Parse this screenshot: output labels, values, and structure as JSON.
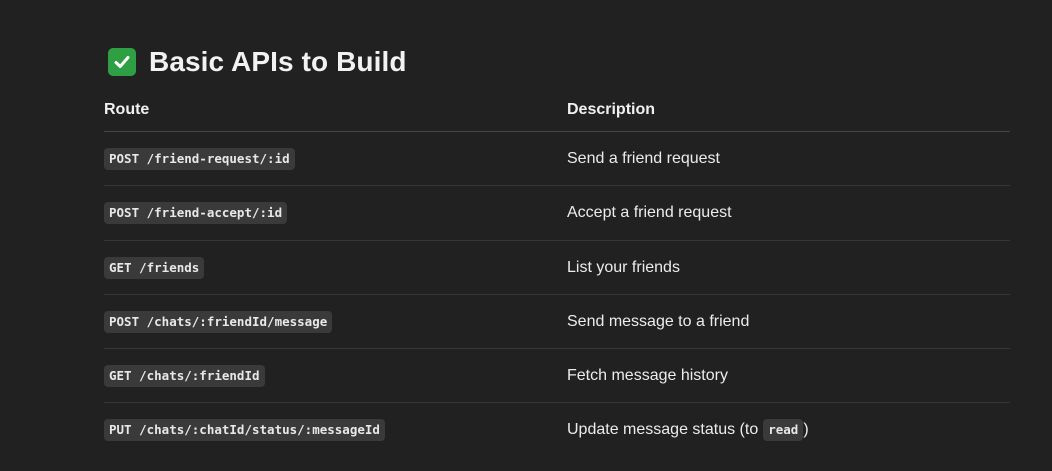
{
  "heading": {
    "icon": "check-mark-button-icon",
    "icon_color": "#2ea043",
    "title": "Basic APIs to Build"
  },
  "table": {
    "headers": {
      "route": "Route",
      "description": "Description"
    },
    "rows": [
      {
        "route": "POST /friend-request/:id",
        "description": "Send a friend request"
      },
      {
        "route": "POST /friend-accept/:id",
        "description": "Accept a friend request"
      },
      {
        "route": "GET /friends",
        "description": "List your friends"
      },
      {
        "route": "POST /chats/:friendId/message",
        "description": "Send message to a friend"
      },
      {
        "route": "GET /chats/:friendId",
        "description": "Fetch message history"
      },
      {
        "route": "PUT /chats/:chatId/status/:messageId",
        "description": "Update message status (to",
        "description_code": "read",
        "description_suffix": ")"
      }
    ]
  }
}
